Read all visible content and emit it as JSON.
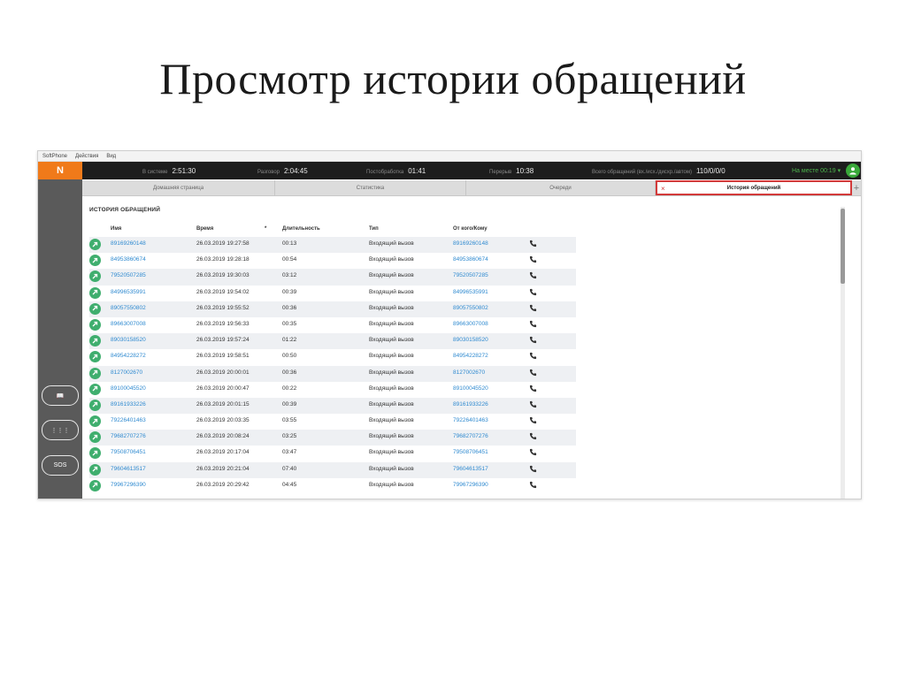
{
  "slide": {
    "title": "Просмотр истории обращений"
  },
  "menu": [
    "SoftPhone",
    "Действия",
    "Вид"
  ],
  "app": {
    "logo": "N",
    "stats": [
      {
        "label": "В системе",
        "value": "2:51:30"
      },
      {
        "label": "Разговор",
        "value": "2:04:45"
      },
      {
        "label": "Постобработка",
        "value": "01:41"
      },
      {
        "label": "Перерыв",
        "value": "10:38"
      },
      {
        "label": "Всего обращений (вх./исх./дисхр./автом)",
        "value": "110/0/0/0"
      }
    ],
    "status": {
      "label": "На месте",
      "value": "00:19"
    }
  },
  "sidebar": {
    "buttons": [
      "📖",
      "⋮⋮⋮",
      "SOS"
    ]
  },
  "tabs": [
    {
      "label": "Домашняя страница"
    },
    {
      "label": "Статистика"
    },
    {
      "label": "Очереди"
    },
    {
      "label": "История обращений",
      "close": "×"
    }
  ],
  "tab_add": "+",
  "history": {
    "title": "ИСТОРИЯ ОБРАЩЕНИЙ",
    "columns": [
      "Имя",
      "Время",
      "*",
      "Длительность",
      "Тип",
      "От кого/Кому"
    ],
    "rows": [
      {
        "name": "89169260148",
        "time": "26.03.2019 19:27:58",
        "duration": "00:13",
        "type": "Входящий вызов",
        "from": "89169260148"
      },
      {
        "name": "84953860674",
        "time": "26.03.2019 19:28:18",
        "duration": "00:54",
        "type": "Входящий вызов",
        "from": "84953860674"
      },
      {
        "name": "79520507285",
        "time": "26.03.2019 19:30:03",
        "duration": "03:12",
        "type": "Входящий вызов",
        "from": "79520507285"
      },
      {
        "name": "84996535991",
        "time": "26.03.2019 19:54:02",
        "duration": "00:39",
        "type": "Входящий вызов",
        "from": "84996535991"
      },
      {
        "name": "89057550802",
        "time": "26.03.2019 19:55:52",
        "duration": "00:36",
        "type": "Входящий вызов",
        "from": "89057550802"
      },
      {
        "name": "89663007008",
        "time": "26.03.2019 19:56:33",
        "duration": "00:35",
        "type": "Входящий вызов",
        "from": "89663007008"
      },
      {
        "name": "89030158520",
        "time": "26.03.2019 19:57:24",
        "duration": "01:22",
        "type": "Входящий вызов",
        "from": "89030158520"
      },
      {
        "name": "84954228272",
        "time": "26.03.2019 19:58:51",
        "duration": "00:50",
        "type": "Входящий вызов",
        "from": "84954228272"
      },
      {
        "name": "8127002670",
        "time": "26.03.2019 20:00:01",
        "duration": "00:36",
        "type": "Входящий вызов",
        "from": "8127002670"
      },
      {
        "name": "89100045520",
        "time": "26.03.2019 20:00:47",
        "duration": "00:22",
        "type": "Входящий вызов",
        "from": "89100045520"
      },
      {
        "name": "89161933226",
        "time": "26.03.2019 20:01:15",
        "duration": "00:39",
        "type": "Входящий вызов",
        "from": "89161933226"
      },
      {
        "name": "79226401463",
        "time": "26.03.2019 20:03:35",
        "duration": "03:55",
        "type": "Входящий вызов",
        "from": "79226401463"
      },
      {
        "name": "79682707276",
        "time": "26.03.2019 20:08:24",
        "duration": "03:25",
        "type": "Входящий вызов",
        "from": "79682707276"
      },
      {
        "name": "79508706451",
        "time": "26.03.2019 20:17:04",
        "duration": "03:47",
        "type": "Входящий вызов",
        "from": "79508706451"
      },
      {
        "name": "79604613517",
        "time": "26.03.2019 20:21:04",
        "duration": "07:40",
        "type": "Входящий вызов",
        "from": "79604613517"
      },
      {
        "name": "79967296390",
        "time": "26.03.2019 20:29:42",
        "duration": "04:45",
        "type": "Входящий вызов",
        "from": "79967296390"
      }
    ]
  },
  "colors": {
    "accent": "#f07a1a",
    "link": "#2f8ad0",
    "status_green": "#39a839",
    "active_tab_border": "#d23a3a"
  }
}
